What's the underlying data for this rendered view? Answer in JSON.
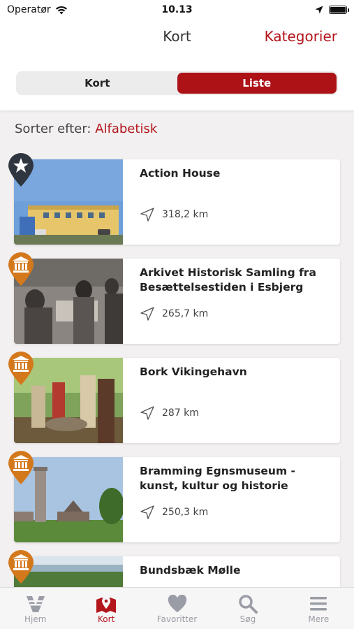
{
  "status_bar": {
    "carrier": "Operatør",
    "time": "10.13"
  },
  "header": {
    "title": "Kort",
    "action_label": "Kategorier"
  },
  "segment": {
    "options": [
      "Kort",
      "Liste"
    ],
    "selected": "Liste"
  },
  "sort": {
    "label": "Sorter efter:",
    "value": "Alfabetisk"
  },
  "items": [
    {
      "title": "Action House",
      "distance": "318,2 km",
      "category_icon": "star-icon",
      "pin_color": "#2f3640"
    },
    {
      "title": "Arkivet Historisk Samling fra Besættelsestiden i Esbjerg",
      "distance": "265,7 km",
      "category_icon": "museum-icon",
      "pin_color": "#d4781c"
    },
    {
      "title": "Bork Vikingehavn",
      "distance": "287 km",
      "category_icon": "museum-icon",
      "pin_color": "#d4781c"
    },
    {
      "title": "Bramming Egnsmuseum - kunst, kultur og historie",
      "distance": "250,3 km",
      "category_icon": "museum-icon",
      "pin_color": "#d4781c"
    },
    {
      "title": "Bundsbæk Mølle",
      "distance": "",
      "category_icon": "museum-icon",
      "pin_color": "#d4781c"
    }
  ],
  "tabbar": {
    "tabs": [
      {
        "label": "Hjem",
        "icon": "v-logo-icon"
      },
      {
        "label": "Kort",
        "icon": "map-pin-icon"
      },
      {
        "label": "Favoritter",
        "icon": "heart-icon"
      },
      {
        "label": "Søg",
        "icon": "search-icon"
      },
      {
        "label": "Mere",
        "icon": "menu-icon"
      }
    ],
    "active": "Kort"
  },
  "colors": {
    "accent": "#b3161c",
    "museum_pin": "#d4781c",
    "star_pin": "#2f3640"
  }
}
